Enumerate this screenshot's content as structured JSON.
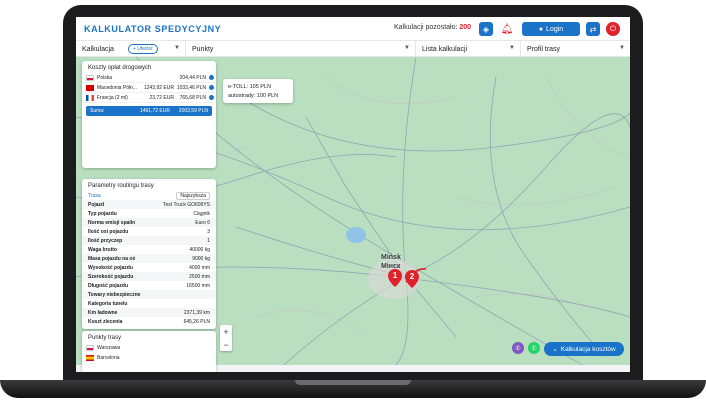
{
  "app": {
    "title": "KALKULATOR SPEDYCYJNY",
    "calculations_left_label": "Kalkulacji pozostało:",
    "calculations_left_value": "200",
    "login_label": "Login"
  },
  "tabs": [
    {
      "label": "Kalkulacja"
    },
    {
      "label": "Punkty"
    },
    {
      "label": "Lista kalkulacji"
    },
    {
      "label": "Profil trasy"
    }
  ],
  "add_button": "+ Utwórz",
  "tolls": {
    "title": "Koszty opłat drogowych",
    "rows": [
      {
        "country": "Polska",
        "amount": "204,44 PLN"
      },
      {
        "country": "Macedonia Półn...",
        "amount_eur": "1243,92 EUR",
        "amount": "1033,46 PLN"
      },
      {
        "country": "Francja (2 ml)",
        "amount_eur": "23,72 EUR",
        "amount": "765,68 PLN"
      }
    ],
    "sum_label": "Suma:",
    "sum_eur": "1461,72 EUR",
    "sum_pln": "2003,59 PLN"
  },
  "toll_box": {
    "line1": "e-TOLL: 105 PLN",
    "line2": "autostrady: 100 PLN"
  },
  "route_params": {
    "title": "Parametry routingu trasy",
    "route_label": "Trasa",
    "route_select": "Najszybsza",
    "rows": [
      {
        "label": "Pojazd",
        "value": "Test Truck GO609YS"
      },
      {
        "label": "Typ pojazdu",
        "value": "Ciągnik"
      },
      {
        "label": "Norma emisji spalin",
        "value": "Euro 6"
      },
      {
        "label": "Ilość osi pojazdu",
        "value": "3"
      },
      {
        "label": "Ilość przyczep",
        "value": "1"
      },
      {
        "label": "Waga brutto",
        "value": "40000 kg"
      },
      {
        "label": "Masa pojazdu na oś",
        "value": "9000 kg"
      },
      {
        "label": "Wysokość pojazdu",
        "value": "4000 mm"
      },
      {
        "label": "Szerokość pojazdu",
        "value": "2500 mm"
      },
      {
        "label": "Długość pojazdu",
        "value": "16500 mm"
      },
      {
        "label": "Towary niebezpieczne",
        "value": ""
      },
      {
        "label": "Kategoria tunelu",
        "value": ""
      },
      {
        "label": "Km ładowne",
        "value": "2371,39 km"
      },
      {
        "label": "Koszt zlecenia",
        "value": "645,26 PLN"
      }
    ]
  },
  "route_points": {
    "title": "Punkty trasy",
    "points": [
      {
        "name": "Warszawa"
      },
      {
        "name": "Barcelona"
      }
    ]
  },
  "map": {
    "city_pl": "Mińsk",
    "city_ru": "Мінск",
    "marker1": "1",
    "marker2": "2"
  },
  "cost_button": "Kalkulacja kosztów",
  "colors": {
    "primary": "#1a73c8",
    "accent_red": "#e0202a",
    "map_green": "#b9dfc0"
  }
}
